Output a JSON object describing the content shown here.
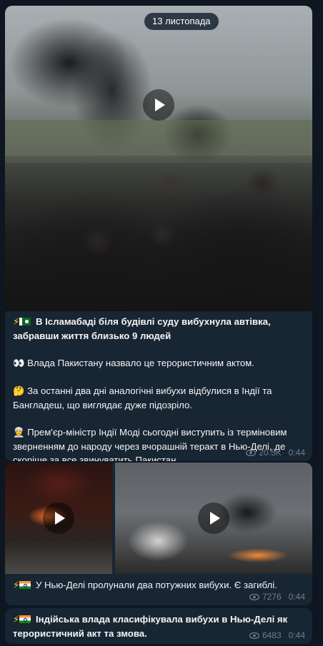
{
  "date_separator": "13 листопада",
  "messages": [
    {
      "media": "video",
      "paragraphs": [
        {
          "emoji": "⚡",
          "flag": "pakistan-flag-icon",
          "bold": true,
          "text": "В Ісламабаді біля будівлі суду вибухнула автівка, забравши життя близько 9 людей"
        },
        {
          "emoji": "👀",
          "bold": false,
          "text": "Влада Пакистану назвало це терористичним актом."
        },
        {
          "emoji": "🤔",
          "bold": false,
          "text": "За останні два дні аналогічні вибухи відбулися в Індії та Бангладеш, що виглядає дуже підозріло."
        },
        {
          "emoji": "👳",
          "bold": false,
          "text": "Прем'єр-міністр Індії Моді сьогодні виступить із терміновим зверненням до народу через вчорашній теракт в Нью-Делі, де скоріше за все звинуватить Пакистан."
        }
      ],
      "views": "20.5K",
      "time": "0:44"
    },
    {
      "media": "two-videos",
      "emoji": "⚡",
      "flag": "india-flag-icon",
      "text": "У Нью-Делі пролунали два потужних вибухи. Є загиблі.",
      "views": "7276",
      "time": "0:44"
    },
    {
      "emoji": "⚡",
      "flag": "india-flag-icon",
      "text": "Індійська влада класифікувала вибухи в Нью-Делі як терористичний акт та змова.",
      "views": "6483",
      "time": "0:44"
    }
  ],
  "colors": {
    "background": "#0e1621",
    "bubble": "#182533",
    "meta_text": "#6d7f8f",
    "text": "#f5f5f5"
  }
}
